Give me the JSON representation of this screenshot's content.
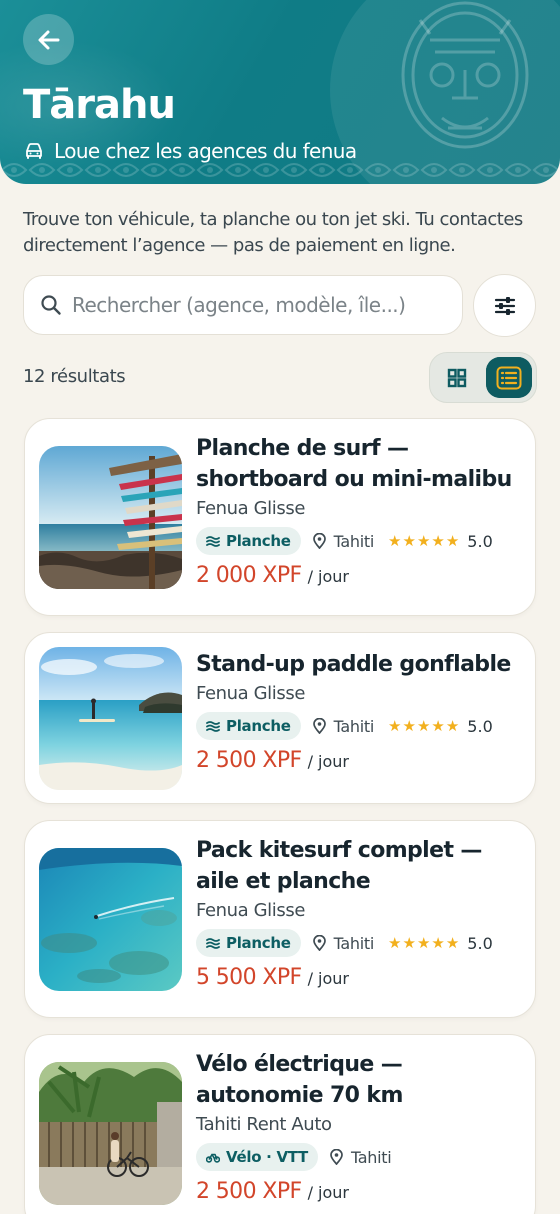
{
  "header": {
    "title": "Tārahu",
    "subtitle": "Loue chez les agences du fenua",
    "back_label": "Retour"
  },
  "intro": "Trouve ton véhicule, ta planche ou ton jet ski. Tu contactes directement l’agence — pas de paiement en ligne.",
  "search": {
    "placeholder": "Rechercher (agence, modèle, île...)",
    "value": ""
  },
  "results": {
    "count_label": "12 résultats"
  },
  "view_toggle": {
    "active": "list",
    "options": [
      "grid",
      "list"
    ]
  },
  "colors": {
    "brand_teal": "#0f7c86",
    "accent_dark": "#0e5b61",
    "price_red": "#d2452a",
    "star_gold": "#f2b01e",
    "background": "#f6f3ec"
  },
  "listings": [
    {
      "title": "Planche de surf — shortboard ou mini-malibu",
      "agency": "Fenua Glisse",
      "category": "Planche",
      "category_icon": "waves-icon",
      "island": "Tahiti",
      "rating": "5.0",
      "stars": 5,
      "price": "2 000 XPF",
      "unit": "/ jour",
      "image": "surfboards-rack"
    },
    {
      "title": "Stand-up paddle gonflable",
      "agency": "Fenua Glisse",
      "category": "Planche",
      "category_icon": "waves-icon",
      "island": "Tahiti",
      "rating": "5.0",
      "stars": 5,
      "price": "2 500 XPF",
      "unit": "/ jour",
      "image": "paddle-lagoon"
    },
    {
      "title": "Pack kitesurf complet — aile et planche",
      "agency": "Fenua Glisse",
      "category": "Planche",
      "category_icon": "waves-icon",
      "island": "Tahiti",
      "rating": "5.0",
      "stars": 5,
      "price": "5 500 XPF",
      "unit": "/ jour",
      "image": "kitesurf-reef"
    },
    {
      "title": "Vélo électrique — autonomie 70 km",
      "agency": "Tahiti Rent Auto",
      "category": "Vélo · VTT",
      "category_icon": "bike-icon",
      "island": "Tahiti",
      "rating": "",
      "stars": 0,
      "price": "2 500 XPF",
      "unit": "/ jour",
      "image": "ebike-palms"
    }
  ]
}
